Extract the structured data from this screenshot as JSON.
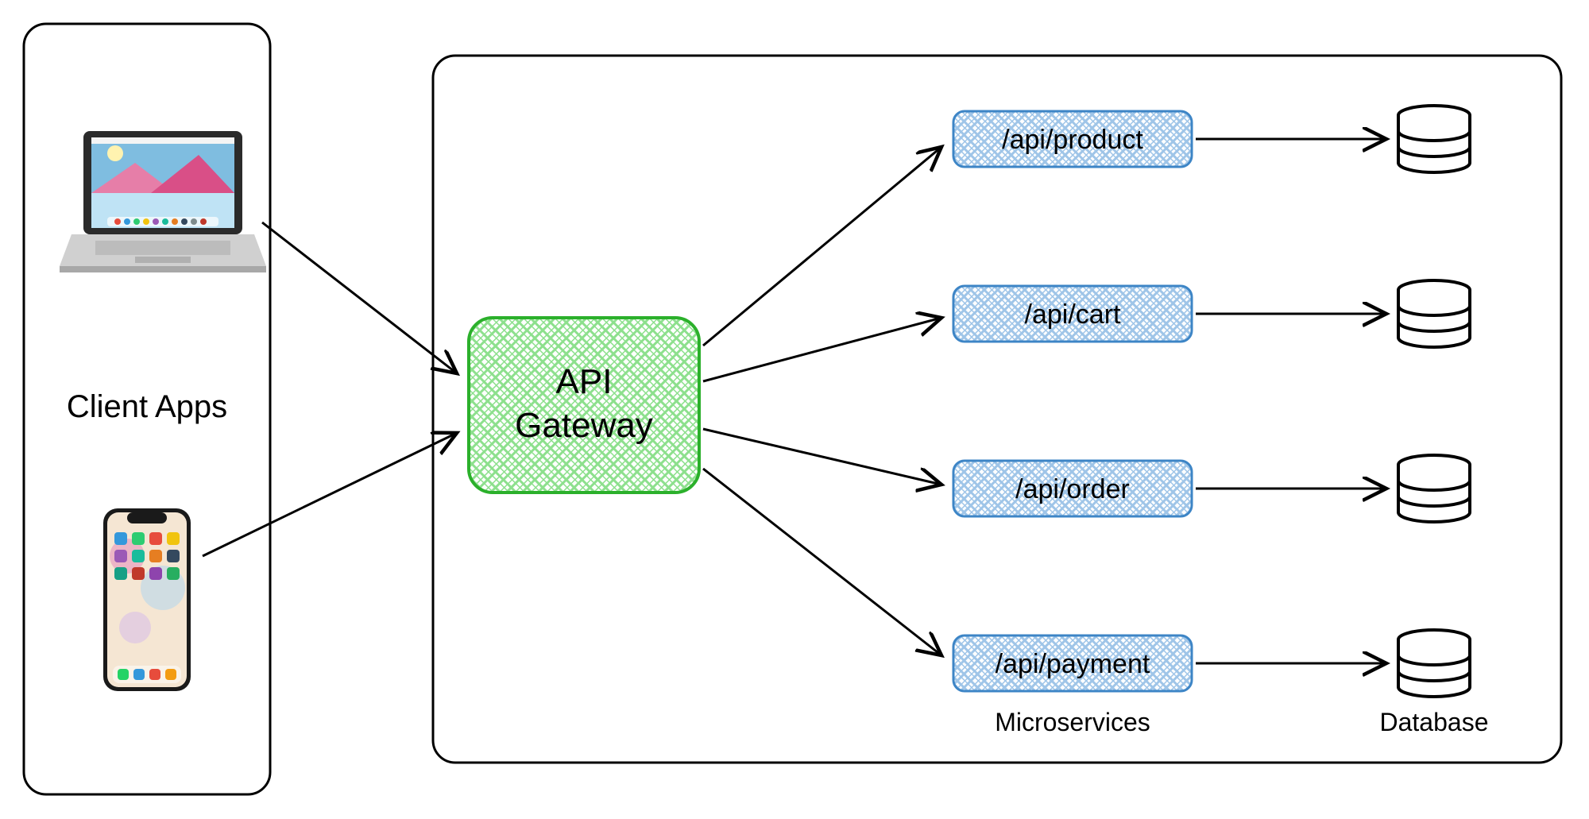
{
  "clientApps": {
    "label": "Client Apps"
  },
  "gateway": {
    "line1": "API",
    "line2": "Gateway"
  },
  "microservices": {
    "label": "Microservices",
    "items": [
      {
        "path": "/api/product"
      },
      {
        "path": "/api/cart"
      },
      {
        "path": "/api/order"
      },
      {
        "path": "/api/payment"
      }
    ]
  },
  "database": {
    "label": "Database"
  }
}
